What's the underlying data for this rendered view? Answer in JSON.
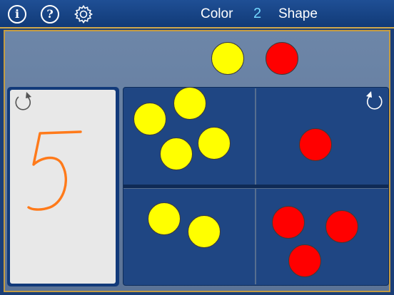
{
  "toolbar": {
    "info_icon": "info-icon",
    "info_glyph": "i",
    "help_icon": "help-icon",
    "help_glyph": "?",
    "settings_icon": "gear-icon"
  },
  "mode": {
    "left_label": "Color",
    "number": "2",
    "right_label": "Shape"
  },
  "sort_targets": [
    {
      "color": "yellow"
    },
    {
      "color": "red"
    }
  ],
  "writing_card": {
    "reset_icon": "clockwise-reset-icon",
    "handwritten_digit": "5",
    "ink_color": "#ff7a1a"
  },
  "grid": {
    "reset_icon": "counterclockwise-reset-icon",
    "cells": [
      {
        "name": "top-left",
        "yellow": 4,
        "red": 0
      },
      {
        "name": "top-right",
        "yellow": 0,
        "red": 1
      },
      {
        "name": "bottom-left",
        "yellow": 2,
        "red": 0
      },
      {
        "name": "bottom-right",
        "yellow": 0,
        "red": 3
      }
    ]
  },
  "colors": {
    "yellow": "#ffff00",
    "red": "#ff0000",
    "highlight": "#73d7ff",
    "border_gold": "#c49c43"
  }
}
